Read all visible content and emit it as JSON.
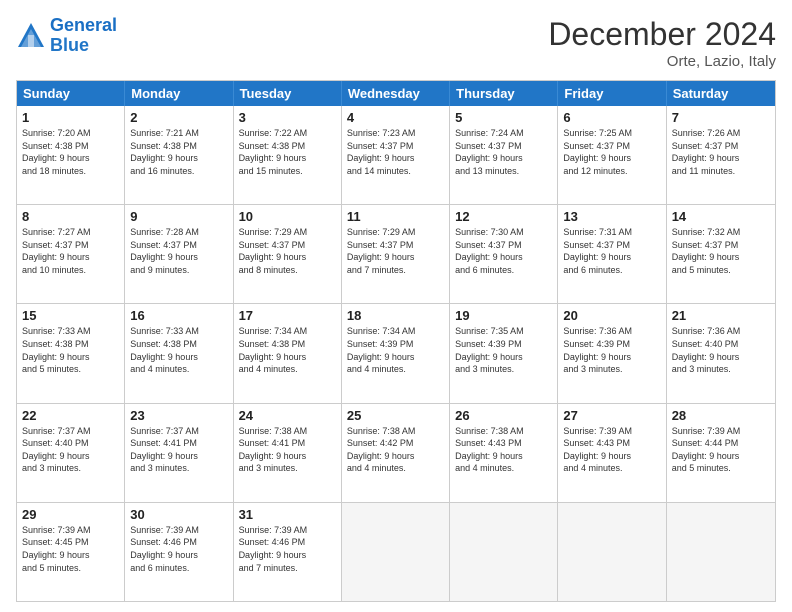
{
  "header": {
    "logo_line1": "General",
    "logo_line2": "Blue",
    "month": "December 2024",
    "location": "Orte, Lazio, Italy"
  },
  "days_of_week": [
    "Sunday",
    "Monday",
    "Tuesday",
    "Wednesday",
    "Thursday",
    "Friday",
    "Saturday"
  ],
  "weeks": [
    [
      {
        "day": "1",
        "text": "Sunrise: 7:20 AM\nSunset: 4:38 PM\nDaylight: 9 hours\nand 18 minutes."
      },
      {
        "day": "2",
        "text": "Sunrise: 7:21 AM\nSunset: 4:38 PM\nDaylight: 9 hours\nand 16 minutes."
      },
      {
        "day": "3",
        "text": "Sunrise: 7:22 AM\nSunset: 4:38 PM\nDaylight: 9 hours\nand 15 minutes."
      },
      {
        "day": "4",
        "text": "Sunrise: 7:23 AM\nSunset: 4:37 PM\nDaylight: 9 hours\nand 14 minutes."
      },
      {
        "day": "5",
        "text": "Sunrise: 7:24 AM\nSunset: 4:37 PM\nDaylight: 9 hours\nand 13 minutes."
      },
      {
        "day": "6",
        "text": "Sunrise: 7:25 AM\nSunset: 4:37 PM\nDaylight: 9 hours\nand 12 minutes."
      },
      {
        "day": "7",
        "text": "Sunrise: 7:26 AM\nSunset: 4:37 PM\nDaylight: 9 hours\nand 11 minutes."
      }
    ],
    [
      {
        "day": "8",
        "text": "Sunrise: 7:27 AM\nSunset: 4:37 PM\nDaylight: 9 hours\nand 10 minutes."
      },
      {
        "day": "9",
        "text": "Sunrise: 7:28 AM\nSunset: 4:37 PM\nDaylight: 9 hours\nand 9 minutes."
      },
      {
        "day": "10",
        "text": "Sunrise: 7:29 AM\nSunset: 4:37 PM\nDaylight: 9 hours\nand 8 minutes."
      },
      {
        "day": "11",
        "text": "Sunrise: 7:29 AM\nSunset: 4:37 PM\nDaylight: 9 hours\nand 7 minutes."
      },
      {
        "day": "12",
        "text": "Sunrise: 7:30 AM\nSunset: 4:37 PM\nDaylight: 9 hours\nand 6 minutes."
      },
      {
        "day": "13",
        "text": "Sunrise: 7:31 AM\nSunset: 4:37 PM\nDaylight: 9 hours\nand 6 minutes."
      },
      {
        "day": "14",
        "text": "Sunrise: 7:32 AM\nSunset: 4:37 PM\nDaylight: 9 hours\nand 5 minutes."
      }
    ],
    [
      {
        "day": "15",
        "text": "Sunrise: 7:33 AM\nSunset: 4:38 PM\nDaylight: 9 hours\nand 5 minutes."
      },
      {
        "day": "16",
        "text": "Sunrise: 7:33 AM\nSunset: 4:38 PM\nDaylight: 9 hours\nand 4 minutes."
      },
      {
        "day": "17",
        "text": "Sunrise: 7:34 AM\nSunset: 4:38 PM\nDaylight: 9 hours\nand 4 minutes."
      },
      {
        "day": "18",
        "text": "Sunrise: 7:34 AM\nSunset: 4:39 PM\nDaylight: 9 hours\nand 4 minutes."
      },
      {
        "day": "19",
        "text": "Sunrise: 7:35 AM\nSunset: 4:39 PM\nDaylight: 9 hours\nand 3 minutes."
      },
      {
        "day": "20",
        "text": "Sunrise: 7:36 AM\nSunset: 4:39 PM\nDaylight: 9 hours\nand 3 minutes."
      },
      {
        "day": "21",
        "text": "Sunrise: 7:36 AM\nSunset: 4:40 PM\nDaylight: 9 hours\nand 3 minutes."
      }
    ],
    [
      {
        "day": "22",
        "text": "Sunrise: 7:37 AM\nSunset: 4:40 PM\nDaylight: 9 hours\nand 3 minutes."
      },
      {
        "day": "23",
        "text": "Sunrise: 7:37 AM\nSunset: 4:41 PM\nDaylight: 9 hours\nand 3 minutes."
      },
      {
        "day": "24",
        "text": "Sunrise: 7:38 AM\nSunset: 4:41 PM\nDaylight: 9 hours\nand 3 minutes."
      },
      {
        "day": "25",
        "text": "Sunrise: 7:38 AM\nSunset: 4:42 PM\nDaylight: 9 hours\nand 4 minutes."
      },
      {
        "day": "26",
        "text": "Sunrise: 7:38 AM\nSunset: 4:43 PM\nDaylight: 9 hours\nand 4 minutes."
      },
      {
        "day": "27",
        "text": "Sunrise: 7:39 AM\nSunset: 4:43 PM\nDaylight: 9 hours\nand 4 minutes."
      },
      {
        "day": "28",
        "text": "Sunrise: 7:39 AM\nSunset: 4:44 PM\nDaylight: 9 hours\nand 5 minutes."
      }
    ],
    [
      {
        "day": "29",
        "text": "Sunrise: 7:39 AM\nSunset: 4:45 PM\nDaylight: 9 hours\nand 5 minutes."
      },
      {
        "day": "30",
        "text": "Sunrise: 7:39 AM\nSunset: 4:46 PM\nDaylight: 9 hours\nand 6 minutes."
      },
      {
        "day": "31",
        "text": "Sunrise: 7:39 AM\nSunset: 4:46 PM\nDaylight: 9 hours\nand 7 minutes."
      },
      {
        "day": "",
        "text": ""
      },
      {
        "day": "",
        "text": ""
      },
      {
        "day": "",
        "text": ""
      },
      {
        "day": "",
        "text": ""
      }
    ]
  ]
}
